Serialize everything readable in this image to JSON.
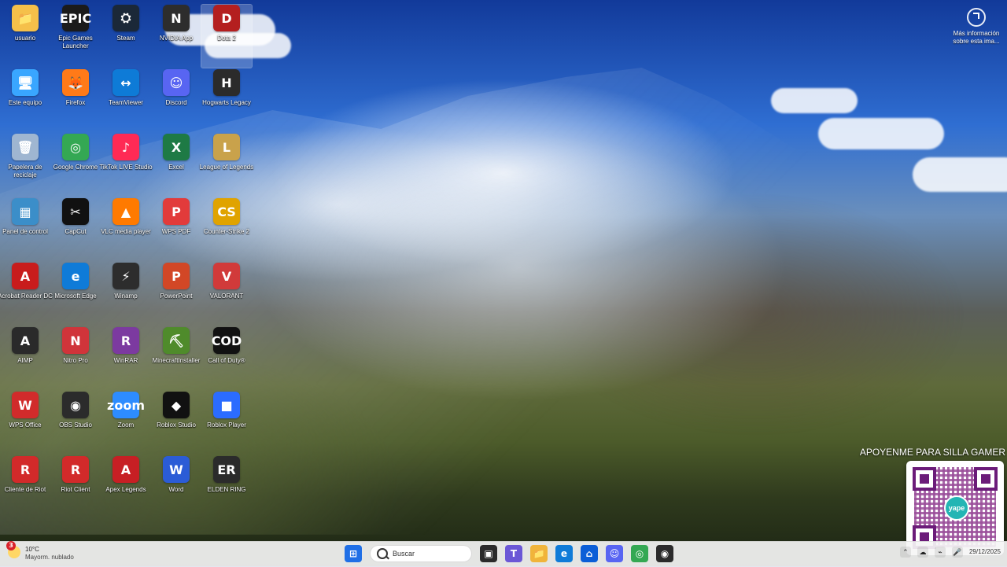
{
  "desktop": {
    "icons": [
      {
        "label": "usuario",
        "glyph": "📁",
        "color": "#f5c04a"
      },
      {
        "label": "Epic Games Launcher",
        "glyph": "EPIC",
        "color": "#1b1b1b"
      },
      {
        "label": "Steam",
        "glyph": "⛭",
        "color": "#1b2838"
      },
      {
        "label": "NVIDIA App",
        "glyph": "N",
        "color": "#2d2d2d"
      },
      {
        "label": "Dota 2",
        "glyph": "D",
        "color": "#b41f1f",
        "selected": true
      },
      {
        "label": "Este equipo",
        "glyph": "🖥",
        "color": "#39a6ff"
      },
      {
        "label": "Firefox",
        "glyph": "🦊",
        "color": "#ff7a18"
      },
      {
        "label": "TeamViewer",
        "glyph": "↔",
        "color": "#0e7bd7"
      },
      {
        "label": "Discord",
        "glyph": "☺",
        "color": "#5865f2"
      },
      {
        "label": "Hogwarts Legacy",
        "glyph": "H",
        "color": "#2b2b2b"
      },
      {
        "label": "Papelera de reciclaje",
        "glyph": "🗑",
        "color": "#9fb6d1"
      },
      {
        "label": "Google Chrome",
        "glyph": "◎",
        "color": "#34a853"
      },
      {
        "label": "TikTok LIVE Studio",
        "glyph": "♪",
        "color": "#ff2a55"
      },
      {
        "label": "Excel",
        "glyph": "X",
        "color": "#1e7a45"
      },
      {
        "label": "League of Legends",
        "glyph": "L",
        "color": "#c9a24b"
      },
      {
        "label": "Panel de control",
        "glyph": "▦",
        "color": "#3b8ec9"
      },
      {
        "label": "CapCut",
        "glyph": "✂",
        "color": "#111111"
      },
      {
        "label": "VLC media player",
        "glyph": "▲",
        "color": "#ff7a00"
      },
      {
        "label": "WPS PDF",
        "glyph": "P",
        "color": "#e23b3b"
      },
      {
        "label": "Counter-Strike 2",
        "glyph": "CS",
        "color": "#e0a300"
      },
      {
        "label": "Acrobat Reader DC",
        "glyph": "A",
        "color": "#c81c1c"
      },
      {
        "label": "Microsoft Edge",
        "glyph": "e",
        "color": "#0f7bd8"
      },
      {
        "label": "Winamp",
        "glyph": "⚡",
        "color": "#2d2d2d"
      },
      {
        "label": "PowerPoint",
        "glyph": "P",
        "color": "#d24726"
      },
      {
        "label": "VALORANT",
        "glyph": "V",
        "color": "#d13a3a"
      },
      {
        "label": "AIMP",
        "glyph": "A",
        "color": "#2a2a2a"
      },
      {
        "label": "Nitro Pro",
        "glyph": "N",
        "color": "#d0343a"
      },
      {
        "label": "WinRAR",
        "glyph": "R",
        "color": "#7c3aa0"
      },
      {
        "label": "MinecraftInstaller",
        "glyph": "⛏",
        "color": "#4f8b2b"
      },
      {
        "label": "Call of Duty®",
        "glyph": "COD",
        "color": "#111111"
      },
      {
        "label": "WPS Office",
        "glyph": "W",
        "color": "#d12b2b"
      },
      {
        "label": "OBS Studio",
        "glyph": "◉",
        "color": "#2b2b2b"
      },
      {
        "label": "Zoom",
        "glyph": "zoom",
        "color": "#2d8cff"
      },
      {
        "label": "Roblox Studio",
        "glyph": "◆",
        "color": "#111111"
      },
      {
        "label": "Roblox Player",
        "glyph": "■",
        "color": "#2b6cff"
      },
      {
        "label": "Cliente de Riot",
        "glyph": "R",
        "color": "#d22a2a"
      },
      {
        "label": "Riot Client",
        "glyph": "R",
        "color": "#d22a2a"
      },
      {
        "label": "Apex Legends",
        "glyph": "A",
        "color": "#c71f24"
      },
      {
        "label": "Word",
        "glyph": "W",
        "color": "#2b5cd6"
      },
      {
        "label": "ELDEN RING",
        "glyph": "ER",
        "color": "#2b2b2b"
      }
    ]
  },
  "topright": {
    "label": "Más información sobre esta ima..."
  },
  "donation": {
    "text": "APOYENME PARA SILLA GAMER",
    "qr_center": "yape"
  },
  "taskbar": {
    "weather": {
      "badge": "3",
      "temp": "10°C",
      "desc": "Mayorm. nublado"
    },
    "search_placeholder": "Buscar",
    "date": "29/12/2025"
  }
}
